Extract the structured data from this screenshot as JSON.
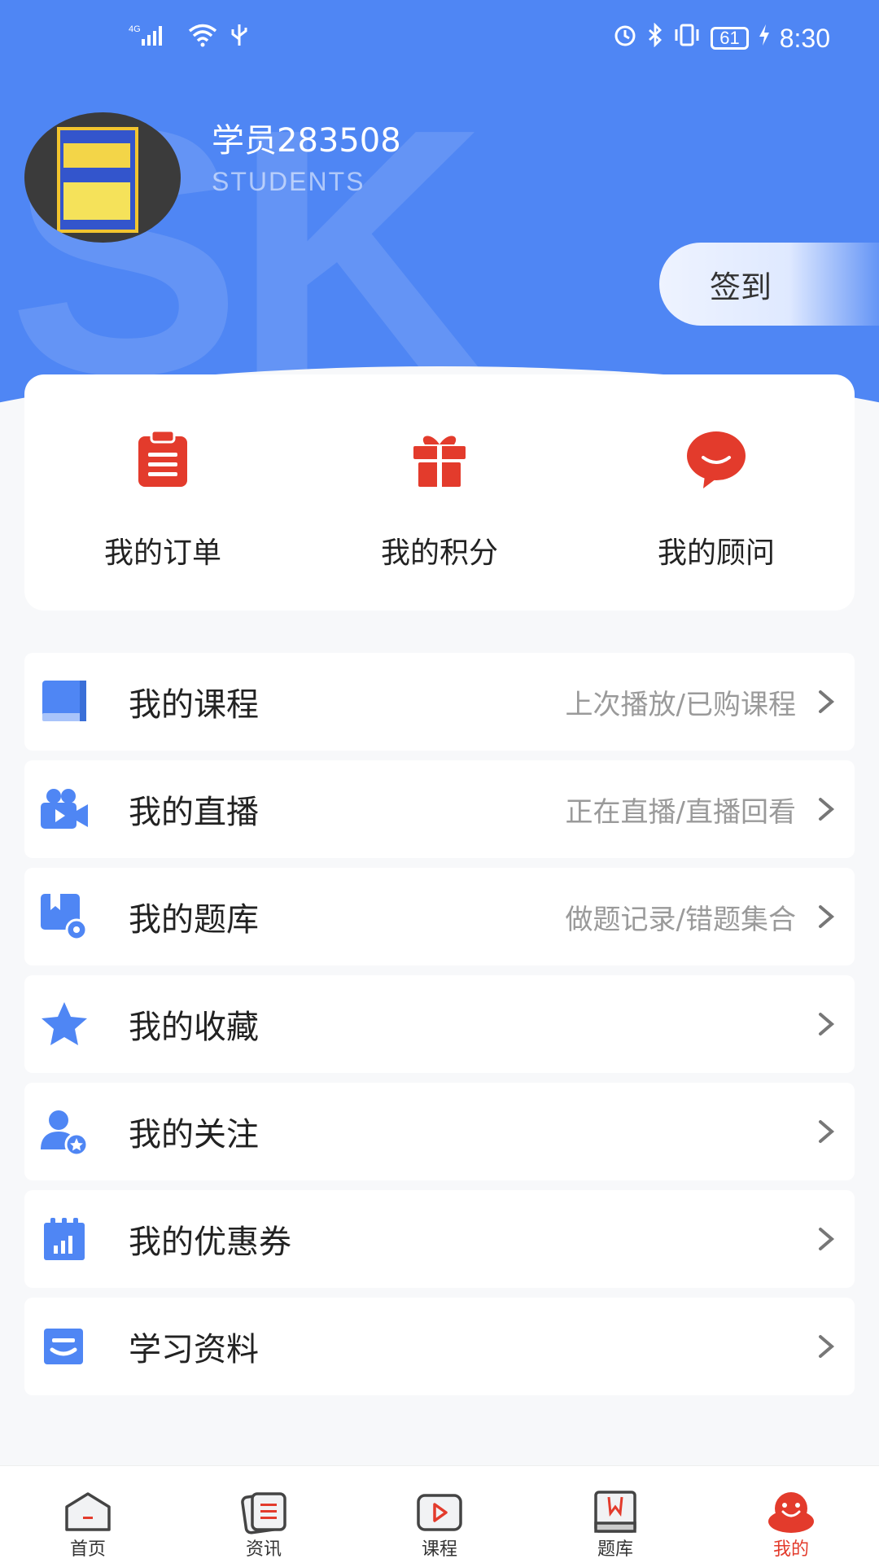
{
  "status_bar": {
    "network": "4G",
    "battery": "61",
    "time": "8:30"
  },
  "header": {
    "watermark": "SK",
    "username": "学员283508",
    "subtitle": "STUDENTS",
    "checkin_label": "签到"
  },
  "quick_actions": [
    {
      "label": "我的订单",
      "icon": "clipboard-icon"
    },
    {
      "label": "我的积分",
      "icon": "gift-icon"
    },
    {
      "label": "我的顾问",
      "icon": "chat-bubble-icon"
    }
  ],
  "menu": [
    {
      "label": "我的课程",
      "sub": "上次播放/已购课程",
      "icon": "book-icon"
    },
    {
      "label": "我的直播",
      "sub": "正在直播/直播回看",
      "icon": "video-camera-icon"
    },
    {
      "label": "我的题库",
      "sub": "做题记录/错题集合",
      "icon": "question-bank-icon"
    },
    {
      "label": "我的收藏",
      "sub": "",
      "icon": "star-icon"
    },
    {
      "label": "我的关注",
      "sub": "",
      "icon": "user-star-icon"
    },
    {
      "label": "我的优惠券",
      "sub": "",
      "icon": "coupon-icon"
    },
    {
      "label": "学习资料",
      "sub": "",
      "icon": "document-icon"
    }
  ],
  "bottom_nav": [
    {
      "label": "首页",
      "icon": "home-icon",
      "active": false
    },
    {
      "label": "资讯",
      "icon": "news-icon",
      "active": false
    },
    {
      "label": "课程",
      "icon": "play-icon",
      "active": false
    },
    {
      "label": "题库",
      "icon": "bookmark-book-icon",
      "active": false
    },
    {
      "label": "我的",
      "icon": "smiley-icon",
      "active": true
    }
  ],
  "colors": {
    "primary_blue": "#4f86f4",
    "accent_red": "#e33b2c",
    "background": "#f7f8fa"
  }
}
